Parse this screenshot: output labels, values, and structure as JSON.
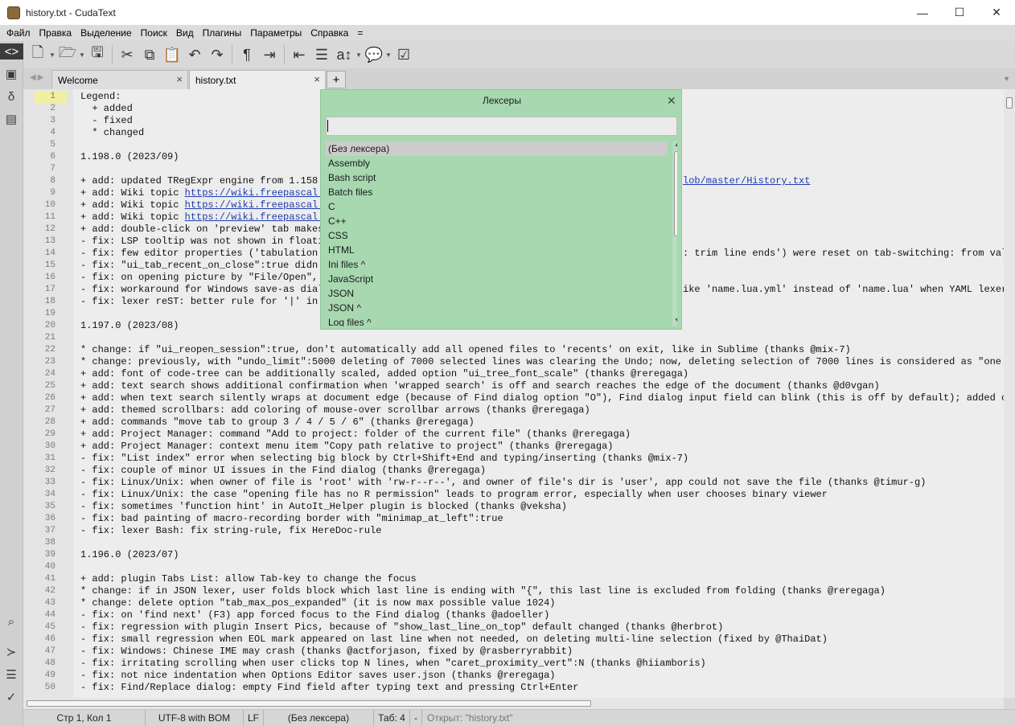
{
  "window": {
    "title": "history.txt - CudaText",
    "minimize": "—",
    "maximize": "☐",
    "close": "✕"
  },
  "menu": [
    "Файл",
    "Правка",
    "Выделение",
    "Поиск",
    "Вид",
    "Плагины",
    "Параметры",
    "Справка",
    "="
  ],
  "sidebar": {
    "top_icons": [
      "code-tree-icon",
      "project-icon",
      "snippets-icon",
      "tabs-icon"
    ],
    "bottom_icons": [
      "search-icon",
      "console-icon",
      "output-icon",
      "validate-icon"
    ]
  },
  "toolbar": {
    "icons": [
      "new-file-icon",
      "open-file-icon",
      "save-icon",
      "cut-icon",
      "copy-icon",
      "paste-icon",
      "undo-icon",
      "redo-icon",
      "unprinted-icon",
      "wrap-icon",
      "indent-icon",
      "unindent-icon",
      "case-icon",
      "comment-icon",
      "checkbox-icon"
    ]
  },
  "tabs": [
    {
      "label": "Welcome",
      "close": "×"
    },
    {
      "label": "history.txt",
      "close": "×"
    }
  ],
  "tab_add": "+",
  "editor": {
    "current_line": 1,
    "lines": [
      {
        "n": "1",
        "t": "Legend:"
      },
      {
        "n": "2",
        "t": "  + added"
      },
      {
        "n": "3",
        "t": "  - fixed"
      },
      {
        "n": "4",
        "t": "  * changed"
      },
      {
        "n": "5",
        "t": ""
      },
      {
        "n": "6",
        "t": "1.198.0 (2023/09)"
      },
      {
        "n": "7",
        "t": ""
      },
      {
        "n": "8",
        "t": "+ add: updated TRegExpr engine from 1.158 t",
        "tail": "lob/master/History.txt"
      },
      {
        "n": "9",
        "t": "+ add: Wiki topic ",
        "link": "https://wiki.freepascal.o"
      },
      {
        "n": "10",
        "t": "+ add: Wiki topic ",
        "link": "https://wiki.freepascal.o"
      },
      {
        "n": "11",
        "t": "+ add: Wiki topic ",
        "link": "https://wiki.freepascal.o"
      },
      {
        "n": "12",
        "t": "+ add: double-click on 'preview' tab makes"
      },
      {
        "n": "13",
        "t": "- fix: LSP tooltip was not shown in floatin"
      },
      {
        "n": "14",
        "t": "- fix: few editor properties ('tabulation s",
        "right": ": trim line ends') were reset on tab-switching: from valu"
      },
      {
        "n": "15",
        "t": "- fix: \"ui_tab_recent_on_close\":true didn't"
      },
      {
        "n": "16",
        "t": "- fix: on opening picture by \"File/Open\", b"
      },
      {
        "n": "17",
        "t": "- fix: workaround for Windows save-as dialo",
        "right": "ike 'name.lua.yml' instead of 'name.lua' when YAML lexer"
      },
      {
        "n": "18",
        "t": "- fix: lexer reST: better rule for '|' in t"
      },
      {
        "n": "19",
        "t": ""
      },
      {
        "n": "20",
        "t": "1.197.0 (2023/08)"
      },
      {
        "n": "21",
        "t": ""
      },
      {
        "n": "22",
        "t": "* change: if \"ui_reopen_session\":true, don't automatically add all opened files to 'recents' on exit, like in Sublime (thanks @mix-7)"
      },
      {
        "n": "23",
        "t": "* change: previously, with \"undo_limit\":5000 deleting of 7000 selected lines was clearing the Undo; now, deleting selection of 7000 lines is considered as \"one acti"
      },
      {
        "n": "24",
        "t": "+ add: font of code-tree can be additionally scaled, added option \"ui_tree_font_scale\" (thanks @reregaga)"
      },
      {
        "n": "25",
        "t": "+ add: text search shows additional confirmation when 'wrapped search' is off and search reaches the edge of the document (thanks @d0vgan)"
      },
      {
        "n": "26",
        "t": "+ add: when text search silently wraps at document edge (because of Find dialog option \"O\"), Find dialog input field can blink (this is off by default); added optio"
      },
      {
        "n": "27",
        "t": "+ add: themed scrollbars: add coloring of mouse-over scrollbar arrows (thanks @reregaga)"
      },
      {
        "n": "28",
        "t": "+ add: commands \"move tab to group 3 / 4 / 5 / 6\" (thanks @reregaga)"
      },
      {
        "n": "29",
        "t": "+ add: Project Manager: command \"Add to project: folder of the current file\" (thanks @reregaga)"
      },
      {
        "n": "30",
        "t": "+ add: Project Manager: context menu item \"Copy path relative to project\" (thanks @reregaga)"
      },
      {
        "n": "31",
        "t": "- fix: \"List index\" error when selecting big block by Ctrl+Shift+End and typing/inserting (thanks @mix-7)"
      },
      {
        "n": "32",
        "t": "- fix: couple of minor UI issues in the Find dialog (thanks @reregaga)"
      },
      {
        "n": "33",
        "t": "- fix: Linux/Unix: when owner of file is 'root' with 'rw-r--r--', and owner of file's dir is 'user', app could not save the file (thanks @timur-g)"
      },
      {
        "n": "34",
        "t": "- fix: Linux/Unix: the case \"opening file has no R permission\" leads to program error, especially when user chooses binary viewer"
      },
      {
        "n": "35",
        "t": "- fix: sometimes 'function hint' in AutoIt_Helper plugin is blocked (thanks @veksha)"
      },
      {
        "n": "36",
        "t": "- fix: bad painting of macro-recording border with \"minimap_at_left\":true"
      },
      {
        "n": "37",
        "t": "- fix: lexer Bash: fix string-rule, fix HereDoc-rule"
      },
      {
        "n": "38",
        "t": ""
      },
      {
        "n": "39",
        "t": "1.196.0 (2023/07)"
      },
      {
        "n": "40",
        "t": ""
      },
      {
        "n": "41",
        "t": "+ add: plugin Tabs List: allow Tab-key to change the focus"
      },
      {
        "n": "42",
        "t": "* change: if in JSON lexer, user folds block which last line is ending with \"{\", this last line is excluded from folding (thanks @reregaga)"
      },
      {
        "n": "43",
        "t": "* change: delete option \"tab_max_pos_expanded\" (it is now max possible value 1024)"
      },
      {
        "n": "44",
        "t": "- fix: on 'find next' (F3) app forced focus to the Find dialog (thanks @adoeller)"
      },
      {
        "n": "45",
        "t": "- fix: regression with plugin Insert Pics, because of \"show_last_line_on_top\" default changed (thanks @herbrot)"
      },
      {
        "n": "46",
        "t": "- fix: small regression when EOL mark appeared on last line when not needed, on deleting multi-line selection (fixed by @ThaiDat)"
      },
      {
        "n": "47",
        "t": "- fix: Windows: Chinese IME may crash (thanks @actforjason, fixed by @rasberryrabbit)"
      },
      {
        "n": "48",
        "t": "- fix: irritating scrolling when user clicks top N lines, when \"caret_proximity_vert\":N (thanks @hiiamboris)"
      },
      {
        "n": "49",
        "t": "- fix: not nice indentation when Options Editor saves user.json (thanks @reregaga)"
      },
      {
        "n": "50",
        "t": "- fix: Find/Replace dialog: empty Find field after typing text and pressing Ctrl+Enter"
      }
    ]
  },
  "status": {
    "position": "Стр 1, Кол 1",
    "encoding": "UTF-8 with BOM",
    "eol": "LF",
    "lexer": "(Без лексера)",
    "tab": "Таб: 4",
    "dash": "-",
    "message": "Открыт: \"history.txt\""
  },
  "lexer_dialog": {
    "title": "Лексеры",
    "close": "✕",
    "input_value": "",
    "items": [
      "(Без лексера)",
      "Assembly",
      "Bash script",
      "Batch files",
      "C",
      "C++",
      "CSS",
      "HTML",
      "Ini files ^",
      "JavaScript",
      "JSON",
      "JSON ^",
      "Log files ^"
    ],
    "selected_index": 0
  }
}
